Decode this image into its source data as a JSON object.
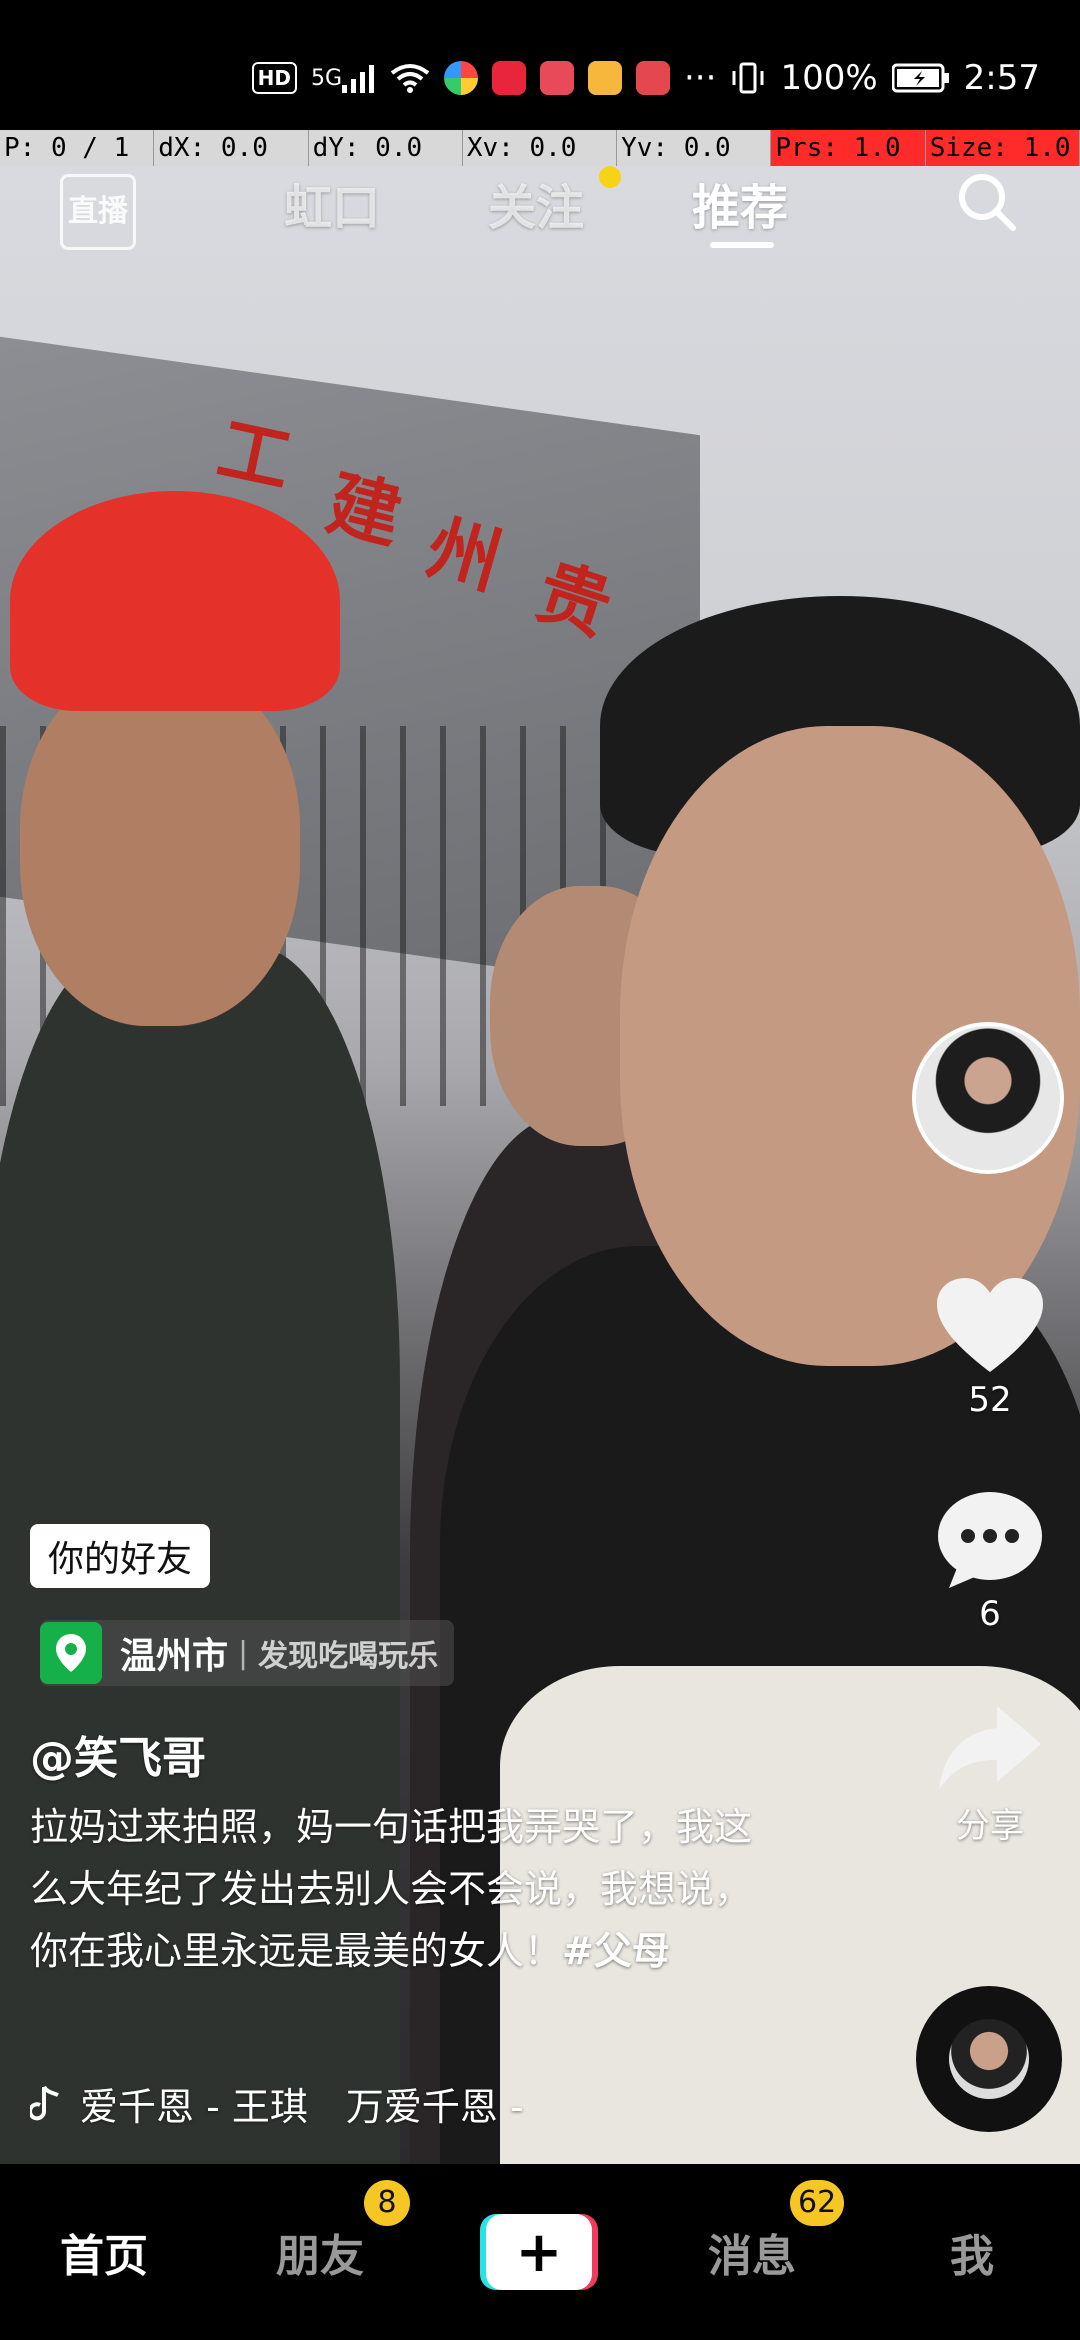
{
  "status_bar": {
    "network": "5G",
    "hd": "HD",
    "battery": "100%",
    "time": "2:57",
    "more": "···"
  },
  "debug_bar": {
    "p": "P: 0 / 1",
    "dx": "dX: 0.0",
    "dy": "dY: 0.0",
    "xv": "Xv: 0.0",
    "yv": "Yv: 0.0",
    "prs": "Prs: 1.0",
    "size": "Size: 1.0"
  },
  "top_nav": {
    "live": "直播",
    "tabs": [
      "虹口",
      "关注",
      "推荐"
    ],
    "active_tab": "推荐"
  },
  "video_sign": [
    "工",
    "建",
    "州",
    "贵"
  ],
  "actions": {
    "likes": "52",
    "comments": "6",
    "share": "分享"
  },
  "post": {
    "friend_badge": "你的好友",
    "location_city": "温州市",
    "location_sub": "发现吃喝玩乐",
    "author": "@笑飞哥",
    "caption": "拉妈过来拍照，妈一句话把我弄哭了，我这么大年纪了发出去别人会不会说，我想说，你在我心里永远是最美的女人！",
    "hashtag": "#父母",
    "music": "爱千恩 - 王琪　万爱千恩 -"
  },
  "bottom_nav": {
    "home": "首页",
    "friends": "朋友",
    "friends_badge": "8",
    "create": "+",
    "messages": "消息",
    "messages_badge": "62",
    "me": "我"
  },
  "colors": {
    "accent_yellow": "#f6c624",
    "location_green": "#16b04a",
    "create_cyan": "#27e3e8",
    "create_red": "#f23a5e"
  }
}
